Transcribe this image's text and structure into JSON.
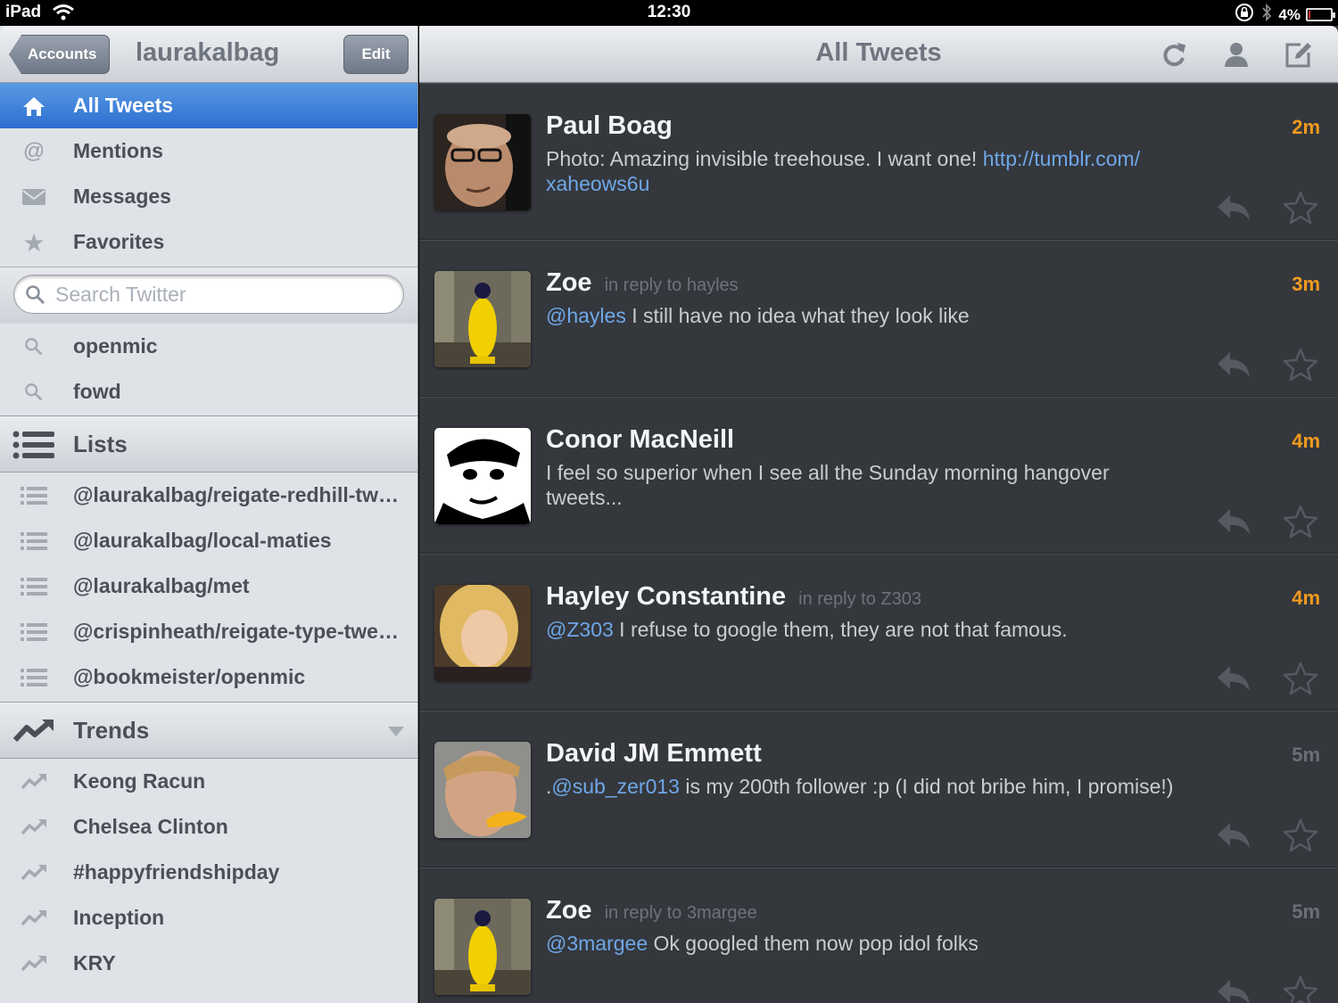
{
  "status": {
    "device": "iPad",
    "time": "12:30",
    "battery": "4%"
  },
  "sidebar": {
    "back_label": "Accounts",
    "title": "laurakalbag",
    "edit_label": "Edit",
    "nav": [
      {
        "label": "All Tweets",
        "icon": "home-icon",
        "active": true
      },
      {
        "label": "Mentions",
        "icon": "at-icon"
      },
      {
        "label": "Messages",
        "icon": "envelope-icon"
      },
      {
        "label": "Favorites",
        "icon": "star-icon"
      }
    ],
    "search_placeholder": "Search Twitter",
    "saved_searches": [
      {
        "label": "openmic"
      },
      {
        "label": "fowd"
      }
    ],
    "lists_header": "Lists",
    "lists": [
      {
        "label": "@laurakalbag/reigate-redhill-tw…"
      },
      {
        "label": "@laurakalbag/local-maties"
      },
      {
        "label": "@laurakalbag/met"
      },
      {
        "label": "@crispinheath/reigate-type-twe…"
      },
      {
        "label": "@bookmeister/openmic"
      }
    ],
    "trends_header": "Trends",
    "trends": [
      {
        "label": "Keong Racun"
      },
      {
        "label": "Chelsea Clinton"
      },
      {
        "label": "#happyfriendshipday"
      },
      {
        "label": "Inception"
      },
      {
        "label": "KRY"
      }
    ]
  },
  "main": {
    "title": "All Tweets",
    "tweets": [
      {
        "name": "Paul Boag",
        "reply": "",
        "time": "2m",
        "text_before": "Photo: Amazing invisible treehouse. I want one! ",
        "link": "http://tumblr.com/ xaheows6u",
        "text_after": "",
        "fresh": true
      },
      {
        "name": "Zoe",
        "reply": "in reply to hayles",
        "time": "3m",
        "text_before": "",
        "link": "@hayles",
        "text_after": " I still have no idea what they look like",
        "fresh": true
      },
      {
        "name": "Conor MacNeill",
        "reply": "",
        "time": "4m",
        "text_before": "I feel so superior when I see all the Sunday morning hangover tweets...",
        "link": "",
        "text_after": "",
        "fresh": true
      },
      {
        "name": "Hayley Constantine",
        "reply": "in reply to Z303",
        "time": "4m",
        "text_before": "",
        "link": "@Z303",
        "text_after": " I refuse to google them, they are not that famous.",
        "fresh": true
      },
      {
        "name": "David JM Emmett",
        "reply": "",
        "time": "5m",
        "text_before": ".",
        "link": "@sub_zer013",
        "text_after": " is my 200th follower :p (I did not bribe him, I promise!)",
        "fresh": false
      },
      {
        "name": "Zoe",
        "reply": "in reply to 3margee",
        "time": "5m",
        "text_before": "",
        "link": "@3margee",
        "text_after": " Ok googled them now pop idol folks",
        "fresh": false
      }
    ]
  },
  "colors": {
    "accent_blue": "#2c6fd1",
    "time_fresh": "#f29a1f",
    "link": "#6fa7e8"
  },
  "battery_level": 0.04
}
